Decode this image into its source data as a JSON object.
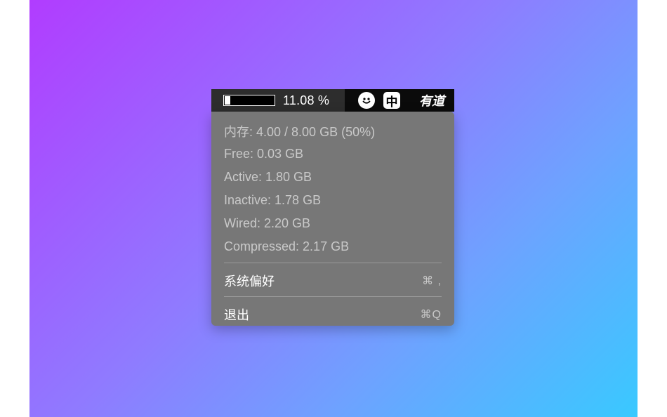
{
  "menubar": {
    "memory_pct": "11.08 %",
    "memory_fill": 0.1108,
    "input_method": "中",
    "youdao": "有道"
  },
  "menu": {
    "info": [
      "内存: 4.00 / 8.00 GB (50%)",
      "Free: 0.03 GB",
      "Active: 1.80 GB",
      "Inactive: 1.78 GB",
      "Wired: 2.20 GB",
      "Compressed: 2.17 GB"
    ],
    "prefs_label": "系统偏好",
    "prefs_shortcut": "⌘ ,",
    "quit_label": "退出",
    "quit_shortcut": "⌘Q"
  }
}
